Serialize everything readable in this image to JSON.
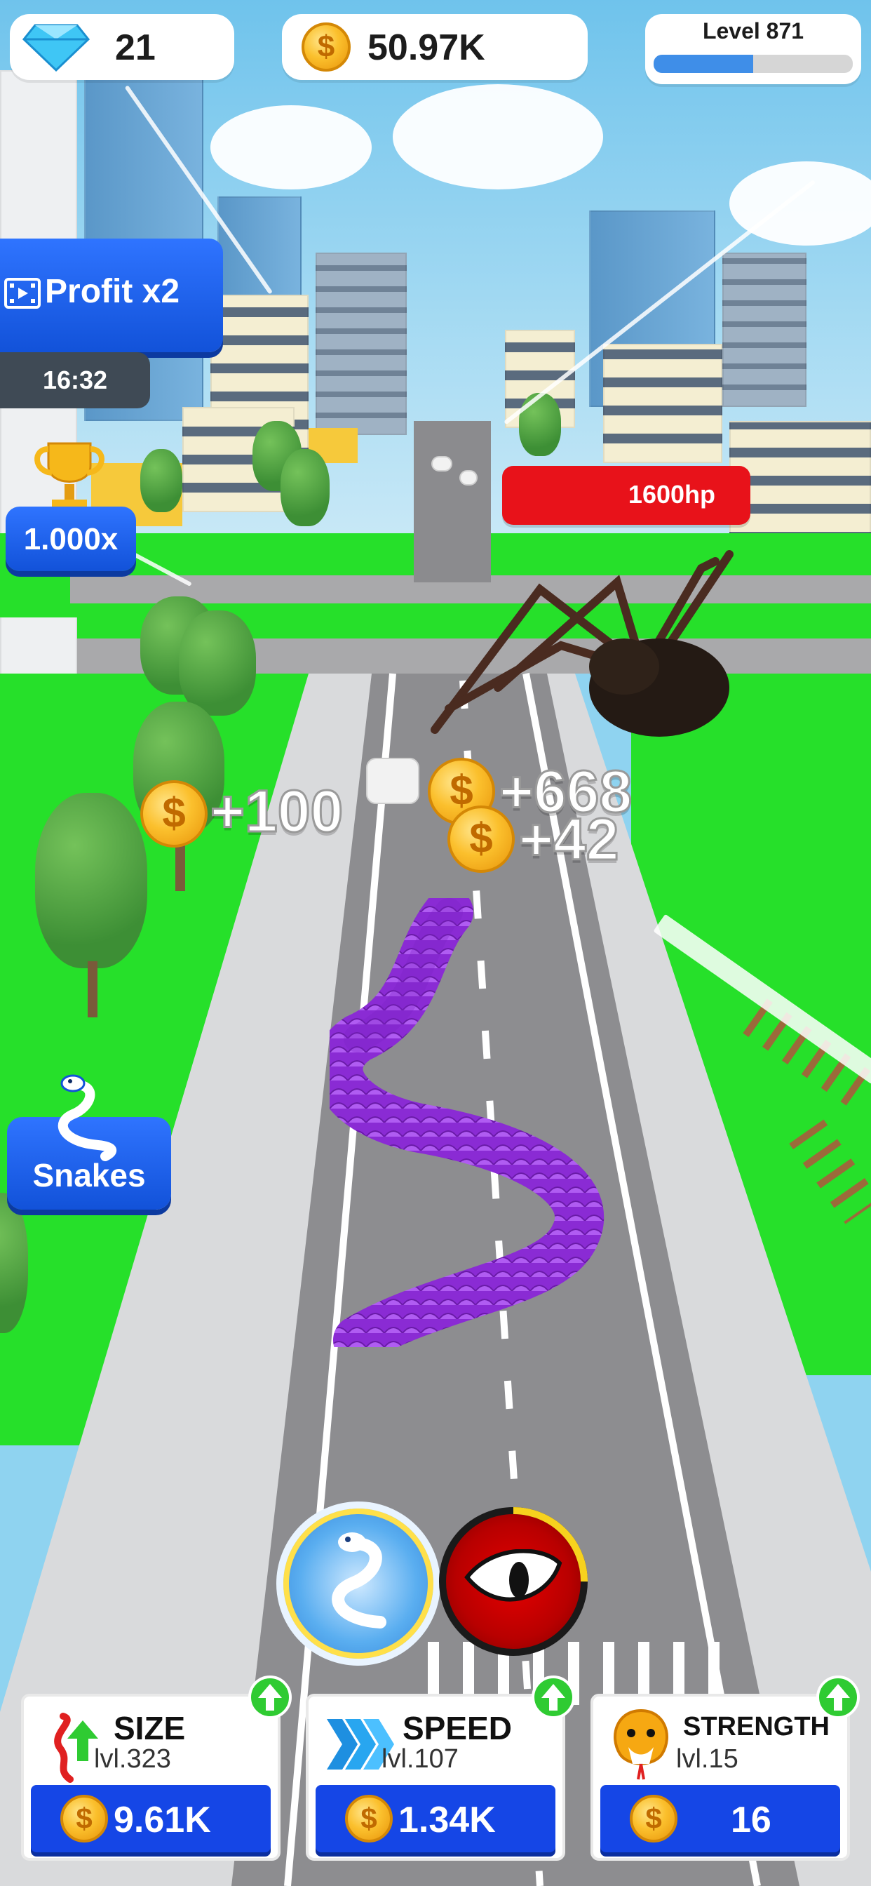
{
  "hud": {
    "gems": "21",
    "coins": "50.97K",
    "level_label": "Level 871",
    "level_progress": 0.5
  },
  "side": {
    "profit_label": "Profit x2",
    "profit_timer": "16:32",
    "multiplier": "1.000x",
    "snakes_label": "Snakes"
  },
  "enemy": {
    "hp": "1600hp"
  },
  "rewards": [
    "+100",
    "+668",
    "+42"
  ],
  "abilities": {
    "dash": "snake-dash-ability",
    "rage": "evil-eye-ability",
    "rage_cooldown": 0.25
  },
  "upgrades": [
    {
      "title": "SIZE",
      "level": "lvl.323",
      "cost": "9.61K",
      "icon": "red-snake-arrow-icon"
    },
    {
      "title": "SPEED",
      "level": "lvl.107",
      "cost": "1.34K",
      "icon": "speed-chevrons-icon"
    },
    {
      "title": "STRENGTH",
      "level": "lvl.15",
      "cost": "16",
      "icon": "cobra-head-icon"
    }
  ],
  "colors": {
    "accent": "#1546e6",
    "hp": "#e8121a",
    "grass": "#26e02a",
    "snake": "#8a2bd4"
  }
}
